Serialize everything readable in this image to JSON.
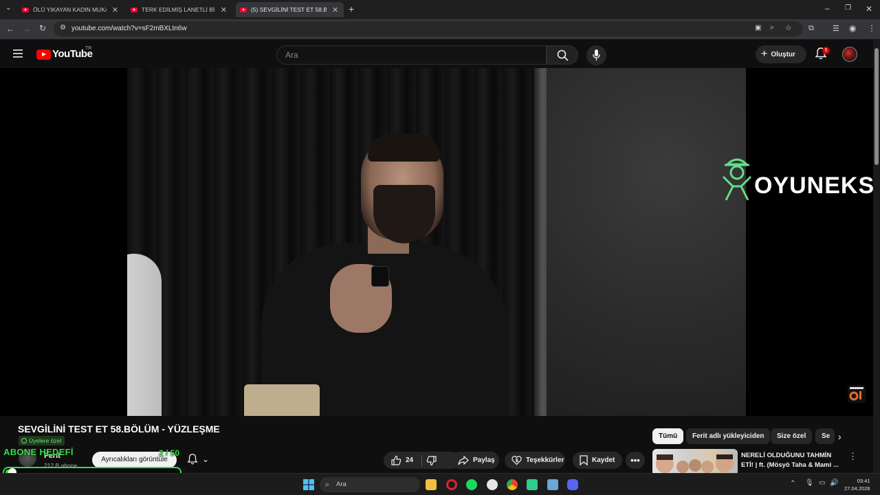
{
  "browser": {
    "tabs": [
      {
        "label": "ÖLÜ YIKAYAN KADIN MUKADDES",
        "active": false
      },
      {
        "label": "TERK EDİLMİŞ LANETLİ BİNAYA",
        "active": false
      },
      {
        "label": "(5) SEVGİLİNİ TEST ET 58.BÖLÜM",
        "active": true
      }
    ],
    "url": "youtube.com/watch?v=sF2mBXLtn6w"
  },
  "header": {
    "logo": "YouTube",
    "region": "TR",
    "search_placeholder": "Ara",
    "create_label": "Oluştur",
    "notification_count": "5"
  },
  "video": {
    "watermark": "OYUNEKS",
    "title": "SEVGİLİNİ TEST ET 58.BÖLÜM - YÜZLEŞME",
    "members_label": "Üyelere özel",
    "channel_name": "Ferit",
    "subscribers": "212 B abone",
    "privileges_label": "Ayrıcalıkları görüntüle",
    "likes": "24",
    "share_label": "Paylaş",
    "thanks_label": "Teşekkürler",
    "save_label": "Kaydet"
  },
  "overlay": {
    "goal_label": "ABONE HEDEFİ",
    "goal_count": "2 / 50",
    "goal_progress": 0.04,
    "accent": "#3bdd4a"
  },
  "chips": [
    "Tümü",
    "Ferit adlı yükleyiciden",
    "Size özel",
    "Se"
  ],
  "recommendation": {
    "title": "NERELİ OLDUĞUNU TAHMİN ETİ! | ft. (Mösyö Taha & Mami ..."
  },
  "taskbar": {
    "search_label": "Ara",
    "time": "03:41",
    "date": "27.04.2026"
  }
}
